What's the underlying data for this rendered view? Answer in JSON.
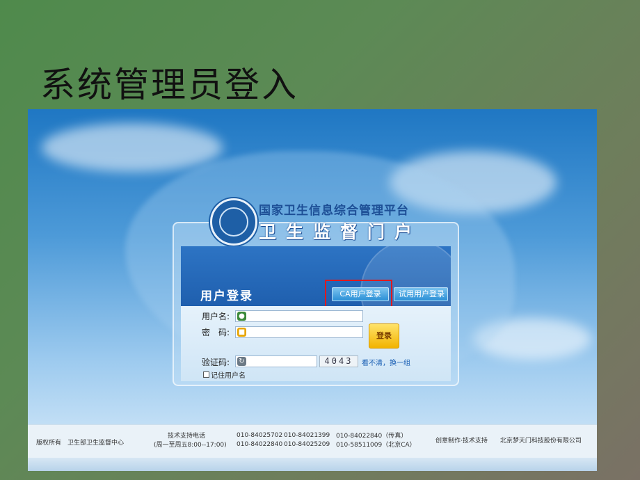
{
  "slide": {
    "title": "系统管理员登入"
  },
  "portal": {
    "platform_name": "国家卫生信息综合管理平台",
    "portal_name": "卫生监督门户",
    "emblem_icon": "health-inspection-emblem-icon"
  },
  "login": {
    "title": "用户登录",
    "tabs": {
      "ca": "CA用户登录",
      "trial": "试用用户登录"
    },
    "username_label": "用户名:",
    "password_label": "密　码:",
    "captcha_label": "验证码:",
    "captcha_code": "4043",
    "captcha_refresh": "看不清，换一组",
    "login_button": "登录",
    "remember_label": "记住用户名"
  },
  "footer": {
    "copyright": "版权所有　卫生部卫生监督中心",
    "support_title": "技术支持电话",
    "support_hours": "(周一至周五8:00--17:00)",
    "phones_col1": [
      "010-84025702",
      "010-84022840"
    ],
    "phones_col2": [
      "010-84021399",
      "010-84025209"
    ],
    "phones_col3": [
      "010-84022840（传真）",
      "010-58511009（北京CA）"
    ],
    "credit": "创意制作·技术支持　　北京梦天门科技股份有限公司"
  },
  "colors": {
    "highlight": "#e0191e",
    "header_blue": "#1f5fae"
  }
}
